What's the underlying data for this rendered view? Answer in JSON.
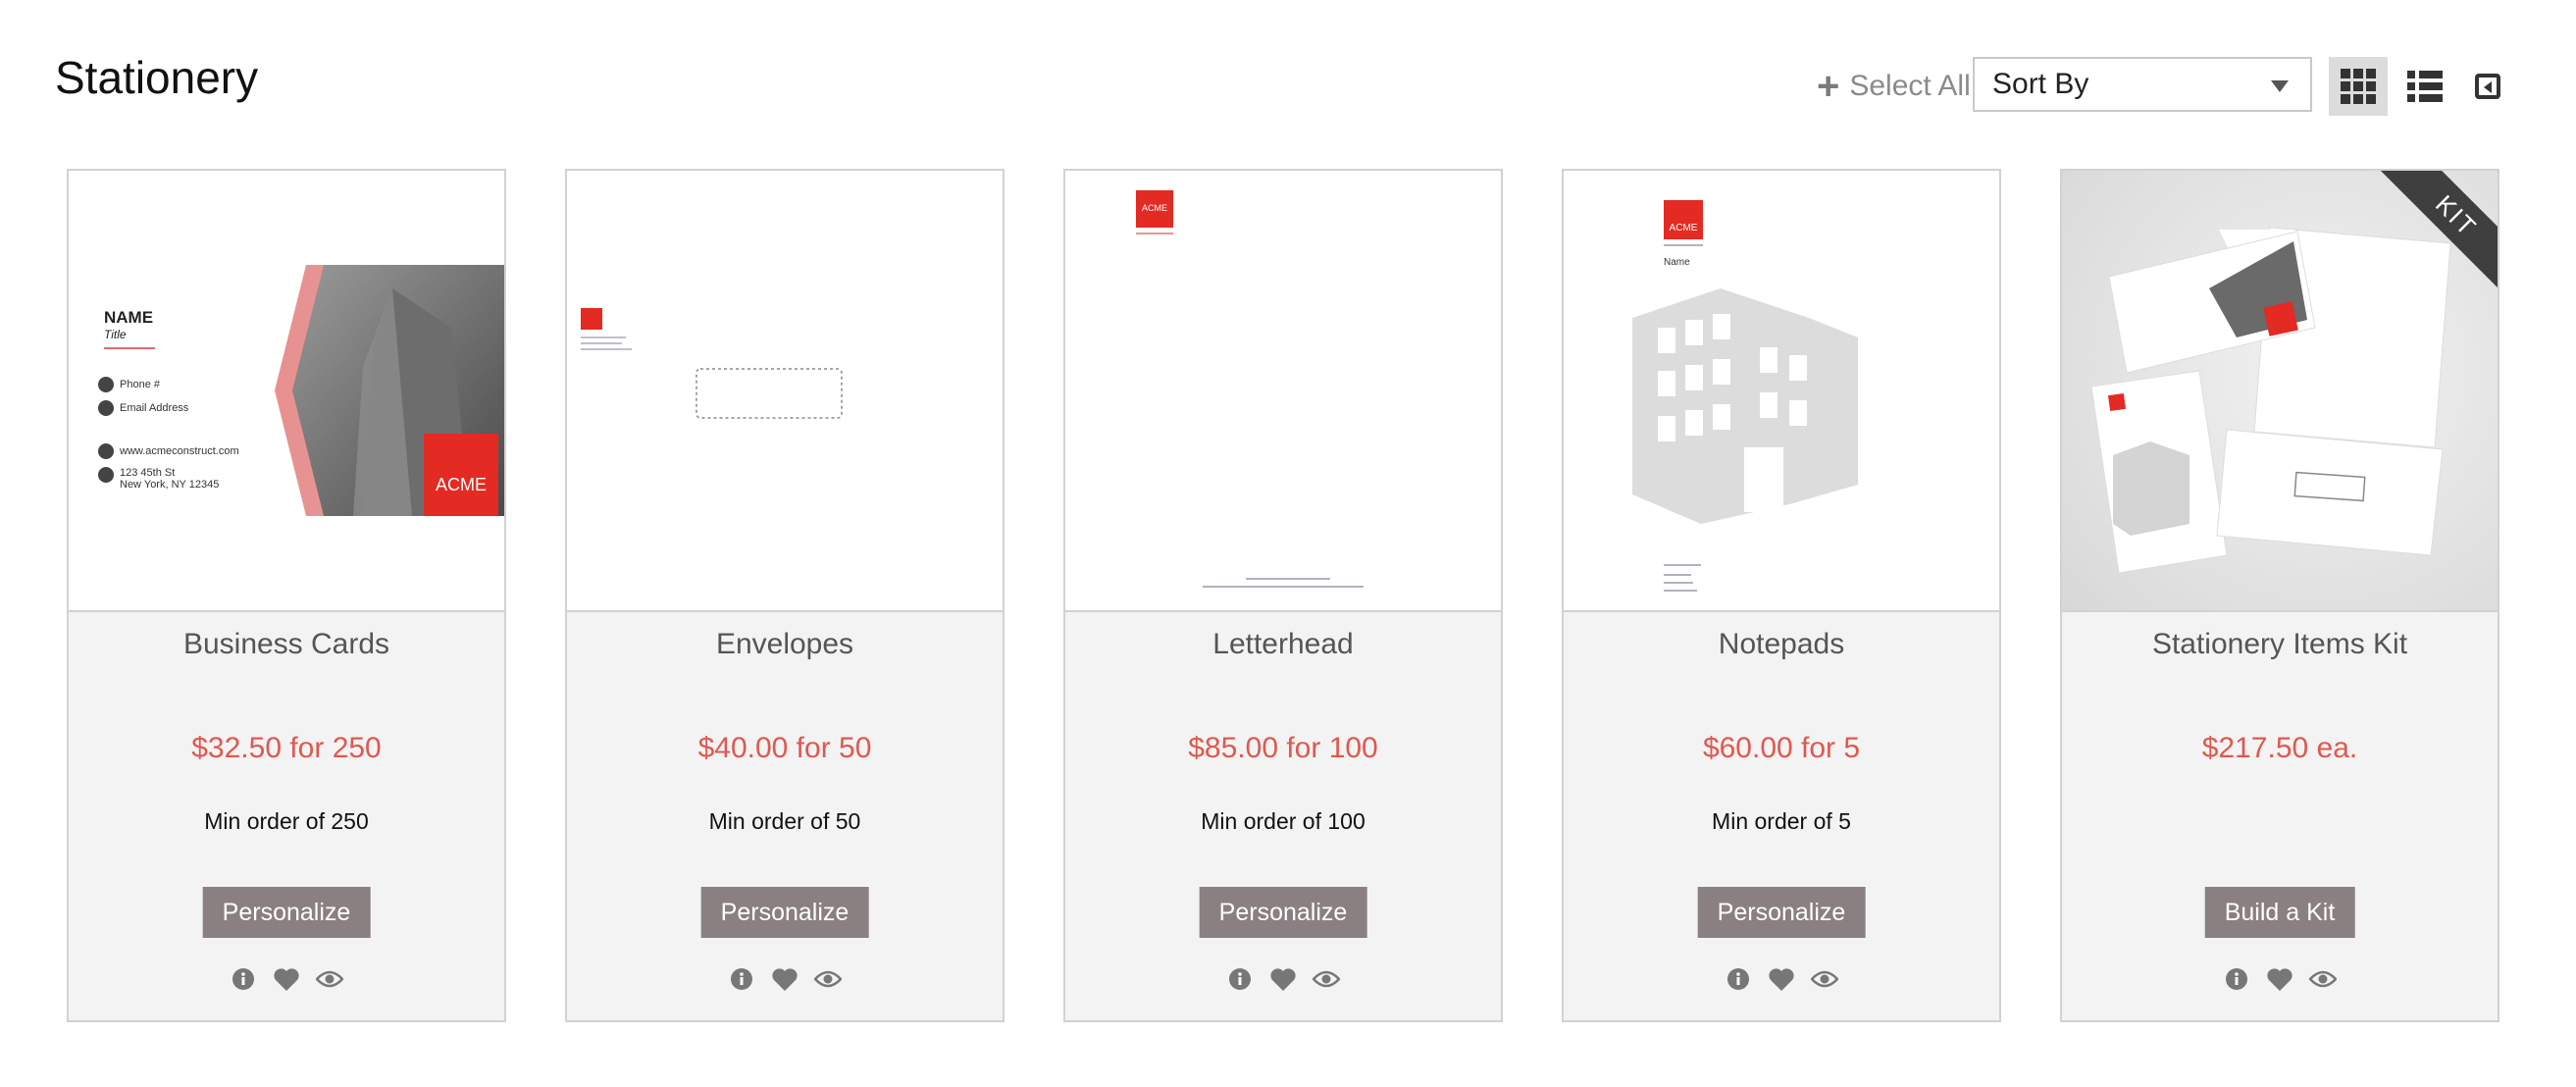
{
  "page": {
    "title": "Stationery"
  },
  "toolbar": {
    "select_all_label": "Select All",
    "sort_label": "Sort By",
    "icons": [
      "plus-icon",
      "grid-view-icon",
      "list-view-icon",
      "collapse-panel-icon"
    ]
  },
  "colors": {
    "price": "#e0584f",
    "button": "#8a8081",
    "brand_red": "#e32a23"
  },
  "products": [
    {
      "name": "Business Cards",
      "price": "$32.50 for 250",
      "min_order": "Min order of 250",
      "action": "Personalize",
      "preview": {
        "name": "NAME",
        "title": "Title",
        "phone": "Phone #",
        "email": "Email Address",
        "website": "www.acmeconstruct.com",
        "address_line1": "123 45th St",
        "address_line2": "New York, NY 12345",
        "logo": "ACME"
      }
    },
    {
      "name": "Envelopes",
      "price": "$40.00 for 50",
      "min_order": "Min order of 50",
      "action": "Personalize",
      "preview": {
        "logo": "ACME"
      }
    },
    {
      "name": "Letterhead",
      "price": "$85.00 for 100",
      "min_order": "Min order of 100",
      "action": "Personalize",
      "preview": {
        "logo": "ACME"
      }
    },
    {
      "name": "Notepads",
      "price": "$60.00 for 5",
      "min_order": "Min order of 5",
      "action": "Personalize",
      "preview": {
        "logo": "ACME",
        "name": "Name"
      }
    },
    {
      "name": "Stationery Items Kit",
      "price": "$217.50 ea.",
      "min_order": "",
      "action": "Build a Kit",
      "preview": {
        "ribbon": "KIT"
      }
    }
  ]
}
